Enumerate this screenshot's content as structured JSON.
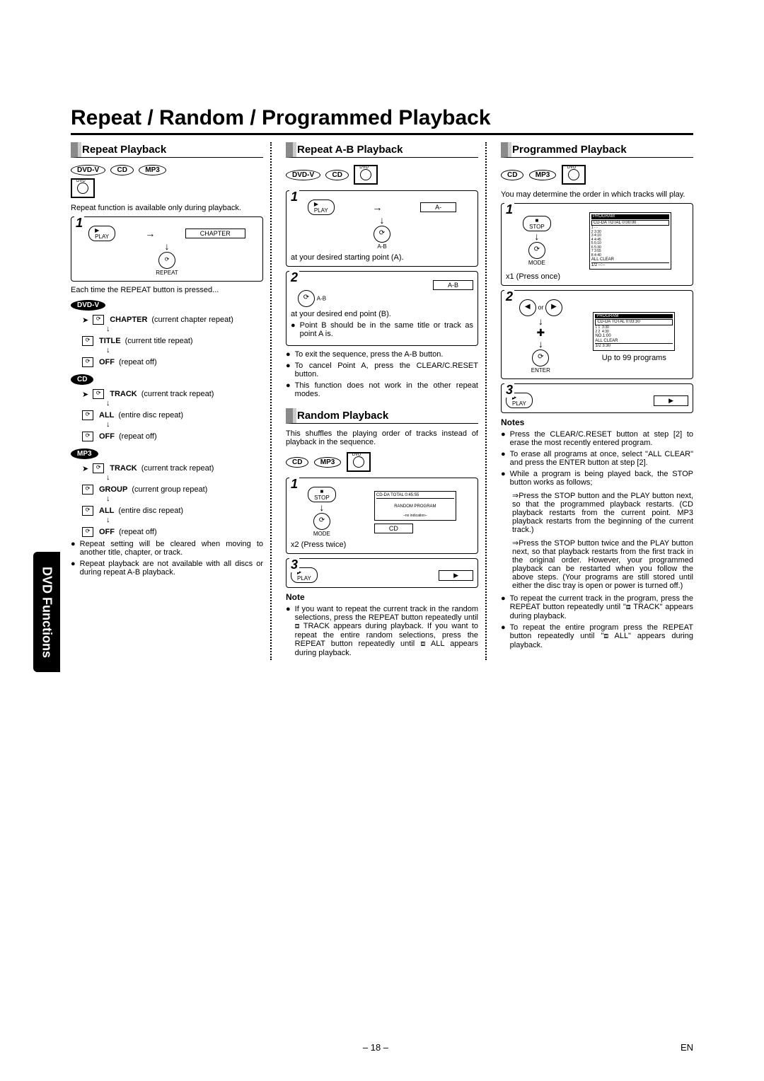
{
  "page_title": "Repeat / Random / Programmed Playback",
  "side_tab": "DVD Functions",
  "footer": {
    "page_num": "– 18 –",
    "lang": "EN"
  },
  "disc_tags": {
    "dvdv": "DVD-V",
    "cd": "CD",
    "mp3": "MP3"
  },
  "repeat_section": {
    "head": "Repeat Playback",
    "intro": "Repeat function is available only during playback.",
    "diagram1": {
      "step": "1",
      "btn_play": "PLAY",
      "osd": "CHAPTER",
      "btn_repeat": "REPEAT"
    },
    "each_time": "Each time the REPEAT button is pressed...",
    "dvd_list": [
      {
        "label": "CHAPTER",
        "mode": "(current chapter repeat)"
      },
      {
        "label": "TITLE",
        "mode": "(current title repeat)"
      },
      {
        "label": "OFF",
        "mode": "(repeat off)"
      }
    ],
    "cd_list": [
      {
        "label": "TRACK",
        "mode": "(current track repeat)"
      },
      {
        "label": "ALL",
        "mode": "(entire disc repeat)"
      },
      {
        "label": "OFF",
        "mode": "(repeat off)"
      }
    ],
    "mp3_list": [
      {
        "label": "TRACK",
        "mode": "(current track repeat)"
      },
      {
        "label": "GROUP",
        "mode": "(current group repeat)"
      },
      {
        "label": "ALL",
        "mode": "(entire disc repeat)"
      },
      {
        "label": "OFF",
        "mode": "(repeat off)"
      }
    ],
    "notes": [
      "Repeat setting will be cleared when moving to another title, chapter, or track.",
      "Repeat playback are not available with all discs or during repeat A-B playback."
    ]
  },
  "ab_section": {
    "head": "Repeat A-B Playback",
    "d1": {
      "step": "1",
      "btn_play": "PLAY",
      "osd": "A-",
      "btn_ab": "A-B",
      "caption": "at your desired starting point (A)."
    },
    "d2": {
      "step": "2",
      "osd": "A-B",
      "btn_ab": "A-B",
      "caption": "at your desired end point (B).",
      "sub": "Point B should be in the same title or track as point A is."
    },
    "notes": [
      "To exit the sequence, press the A-B button.",
      "To cancel Point A, press the CLEAR/C.RESET button.",
      "This function does not work in the other repeat modes."
    ]
  },
  "random_section": {
    "head": "Random Playback",
    "intro": "This shuffles the playing order of tracks instead of playback in the sequence.",
    "d1": {
      "step": "1",
      "btn_stop": "STOP",
      "scr_head": "CD-DA              TOTAL 0:45:55",
      "scr_line": "RANDOM PROGRAM",
      "scr_sub": "–no indication–",
      "osd": "CD",
      "btn_mode": "MODE",
      "caption": "x2 (Press twice)"
    },
    "d2": {
      "step": "3",
      "btn_play": "PLAY",
      "play_icon": "▶"
    },
    "note_head": "Note",
    "note": "If you want to repeat the current track in the random selections, press the REPEAT button repeatedly until ⧈ TRACK appears during playback. If you want to repeat the entire random selections, press the REPEAT button repeatedly until ⧈ ALL appears during playback."
  },
  "prog_section": {
    "head": "Programmed Playback",
    "intro": "You may determine the order in which tracks will play.",
    "d1": {
      "step": "1",
      "btn_stop": "STOP",
      "btn_mode": "MODE",
      "scr_head": "PROGRAM",
      "scr_a": "CD-DA       TOTAL 0:00:00",
      "scr_lines": "1 - -\n2 3:30\n3 4:10\n4 4:45\n5 5:10\n6 5:30\n7 3:55\n8 4:40",
      "scr_b": "ALL CLEAR",
      "scr_c": "1/2                 --:--",
      "caption": "x1 (Press once)"
    },
    "d2": {
      "step": "2",
      "btn_cursor": "◀ or ▶",
      "scr_head": "PROGRAM",
      "scr_a": "CD-DA       TOTAL 0:03:30",
      "scr_lines": "1 1  3:30\n2 2  4:30",
      "scr_b": "NO.1:00\nALL CLEAR",
      "scr_c": "1/2  3:30",
      "btn_enter": "ENTER",
      "caption": "Up to 99 programs"
    },
    "d3": {
      "step": "3",
      "btn_play": "PLAY",
      "play_icon": "▶"
    },
    "notes_head": "Notes",
    "notes": [
      "Press the CLEAR/C.RESET button at step [2] to erase the most recently entered program.",
      "To erase all programs at once, select \"ALL CLEAR\" and press the ENTER button at step [2].",
      "While a program is being played back, the STOP button works as follows;"
    ],
    "subnotes": [
      "⇒Press the STOP button and the PLAY button next, so that the programmed playback restarts. (CD playback restarts from the current point. MP3 playback restarts from the beginning of the current track.)",
      "⇒Press the STOP button twice and the PLAY button next, so that playback restarts from the first track in the original order. However, your programmed playback can be restarted when you follow the above steps. (Your programs are still stored until either the disc tray is open or power is turned off.)"
    ],
    "notes2": [
      "To repeat the current track in the program, press the REPEAT button repeatedly until \"⧈ TRACK\" appears during playback.",
      "To repeat the entire program press the REPEAT button repeatedly until \"⧈ ALL\" appears during playback."
    ]
  }
}
